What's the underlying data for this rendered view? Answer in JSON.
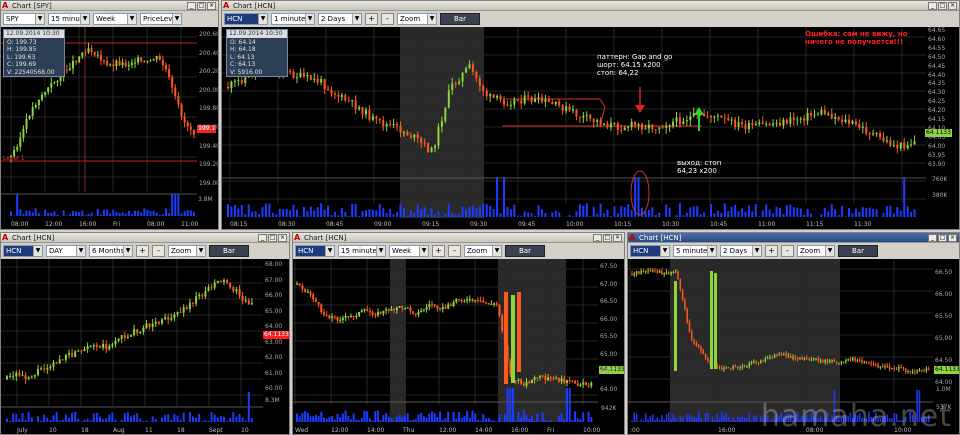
{
  "windows": {
    "spy": {
      "title": "Chart [SPY]",
      "symbol": "SPY",
      "interval": "15 minutes",
      "range": "Week",
      "mode": "PriceLevel",
      "info": {
        "header": "12.09.2014 10:30",
        "o": "O: 199.73",
        "h": "H: 199.85",
        "l": "L: 199.63",
        "c": "C: 199.69",
        "v": "V: 22540568.00"
      },
      "level_label": "Level 1",
      "price_tag": "199.1",
      "vol_label": "3.8M",
      "y_labels": [
        "200.60",
        "200.40",
        "200.20",
        "200.00",
        "199.80",
        "199.60",
        "199.40",
        "199.20",
        "199.00"
      ],
      "x_labels": [
        "08:00",
        "12:00",
        "16:00",
        "Fri",
        "08:00",
        "11:00"
      ]
    },
    "hcn_main": {
      "title": "Chart [HCN]",
      "symbol": "HCN",
      "interval": "1 minute",
      "range": "2 Days",
      "zoom": "Zoom",
      "bar_btn": "Bar",
      "info": {
        "header": "12.09.2014 10:30",
        "o": "O: 64.14",
        "h": "H: 64.18",
        "l": "L: 64.13",
        "c": "C: 64.13",
        "v": "V: 5916.00"
      },
      "annotation_pattern": [
        "паттерн: Gap and go",
        "шорт: 64.15 x200",
        "стоп: 64,22"
      ],
      "annotation_exit": [
        "выход: стоп",
        "64,23 x200"
      ],
      "annotation_error": [
        "Ошибка: сам не вижу, но",
        "ничего не получается!!!"
      ],
      "price_tag": "64.1133",
      "vol_labels": [
        "760K",
        "380K"
      ],
      "y_labels": [
        "64.65",
        "64.60",
        "64.55",
        "64.50",
        "64.45",
        "64.40",
        "64.35",
        "64.30",
        "64.25",
        "64.20",
        "64.15",
        "64.10",
        "64.05",
        "64.00",
        "63.95",
        "63.90"
      ],
      "x_labels": [
        "08:15",
        "08:30",
        "08:45",
        "09:00",
        "09:15",
        "09:30",
        "09:45",
        "10:00",
        "10:15",
        "10:30",
        "10:45",
        "11:00",
        "11:15",
        "11:30"
      ]
    },
    "hcn_daily": {
      "title": "Chart [HCN]",
      "symbol": "HCN",
      "interval": "DAY",
      "range": "6 Months",
      "zoom": "Zoom",
      "bar_btn": "Bar",
      "price_tag": "64.1133",
      "vol_label": "8.3M",
      "y_labels": [
        "68.00",
        "67.00",
        "66.00",
        "65.00",
        "64.00",
        "63.00",
        "62.00",
        "61.00",
        "60.00"
      ],
      "x_labels": [
        "July",
        "10",
        "18",
        "Aug",
        "11",
        "18",
        "Sept",
        "10"
      ]
    },
    "hcn_15m": {
      "title": "Chart [HCN]",
      "symbol": "HCN",
      "interval": "15 minutes",
      "range": "Week",
      "zoom": "Zoom",
      "bar_btn": "Bar",
      "price_tag": "64.1133",
      "vol_label": "942K",
      "y_labels": [
        "67.50",
        "67.00",
        "66.50",
        "66.00",
        "65.50",
        "65.00",
        "64.50",
        "64.00"
      ],
      "x_labels": [
        "Wed",
        "12:00",
        "14:00",
        "Thu",
        "12:00",
        "14:00",
        "16:00",
        "Fri",
        "10:00"
      ]
    },
    "hcn_5m": {
      "title": "Chart [HCN]",
      "symbol": "HCN",
      "interval": "5 minutes",
      "range": "2 Days",
      "zoom": "Zoom",
      "bar_btn": "Bar",
      "price_tag": "64.1133",
      "vol_labels": [
        "1.0M",
        "537K"
      ],
      "y_labels": [
        "66.50",
        "66.00",
        "65.50",
        "65.00",
        "64.50",
        "64.00"
      ],
      "x_labels": [
        ":00",
        "16:00",
        "08:00",
        "10:00"
      ]
    }
  },
  "watermark": "hamaha.net",
  "colors": {
    "up": "#8ed53c",
    "down": "#ff5a1e",
    "volume": "#1e3cff",
    "bg": "#000000"
  }
}
